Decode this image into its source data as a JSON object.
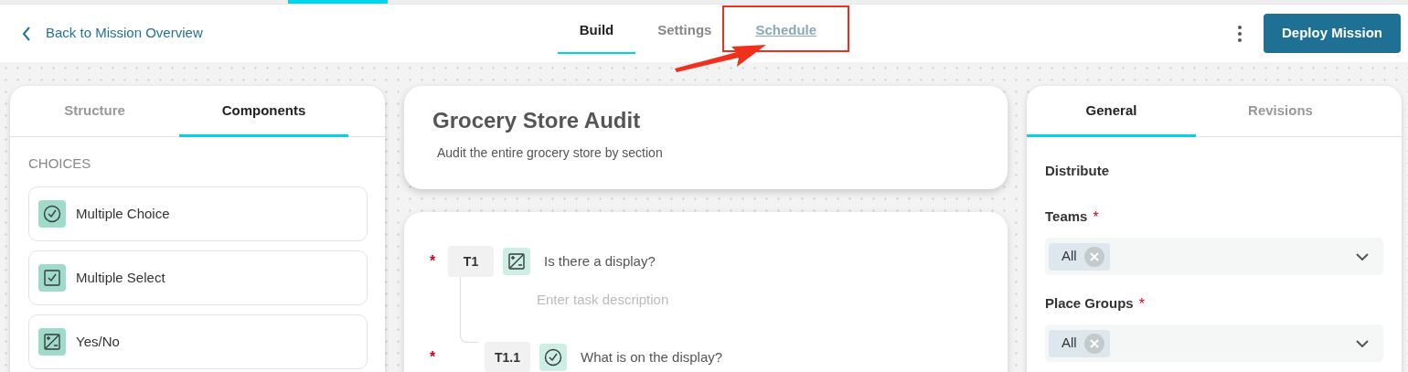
{
  "back_link": {
    "label": "Back to Mission Overview"
  },
  "tabs": [
    {
      "label": "Build",
      "selected": true,
      "highlighted": false
    },
    {
      "label": "Settings",
      "selected": false,
      "highlighted": false
    },
    {
      "label": "Schedule",
      "selected": false,
      "highlighted": true
    }
  ],
  "deploy_button": {
    "label": "Deploy Mission"
  },
  "left_panel": {
    "tabs": [
      {
        "label": "Structure",
        "selected": false
      },
      {
        "label": "Components",
        "selected": true
      }
    ],
    "section": "CHOICES",
    "components": [
      {
        "label": "Multiple Choice",
        "kind": "circle-check"
      },
      {
        "label": "Multiple Select",
        "kind": "square-check"
      },
      {
        "label": "Yes/No",
        "kind": "plus-minus"
      }
    ]
  },
  "mission": {
    "title": "Grocery Store Audit",
    "description": "Audit the entire grocery store by section"
  },
  "tasks": [
    {
      "number": "T1",
      "required_mark": "*",
      "kind": "plus-minus",
      "question": "Is there a display?",
      "placeholder": "Enter task description",
      "children": [
        {
          "number": "T1.1",
          "required_mark": "*",
          "kind": "circle-check",
          "question": "What is on the display?"
        }
      ]
    }
  ],
  "right_panel": {
    "tabs": [
      {
        "label": "General",
        "selected": true
      },
      {
        "label": "Revisions",
        "selected": false
      }
    ],
    "section": "Distribute",
    "fields": [
      {
        "label": "Teams",
        "required_mark": "*",
        "tags": [
          "All"
        ]
      },
      {
        "label": "Place Groups",
        "required_mark": "*",
        "tags": [
          "All"
        ]
      }
    ]
  }
}
